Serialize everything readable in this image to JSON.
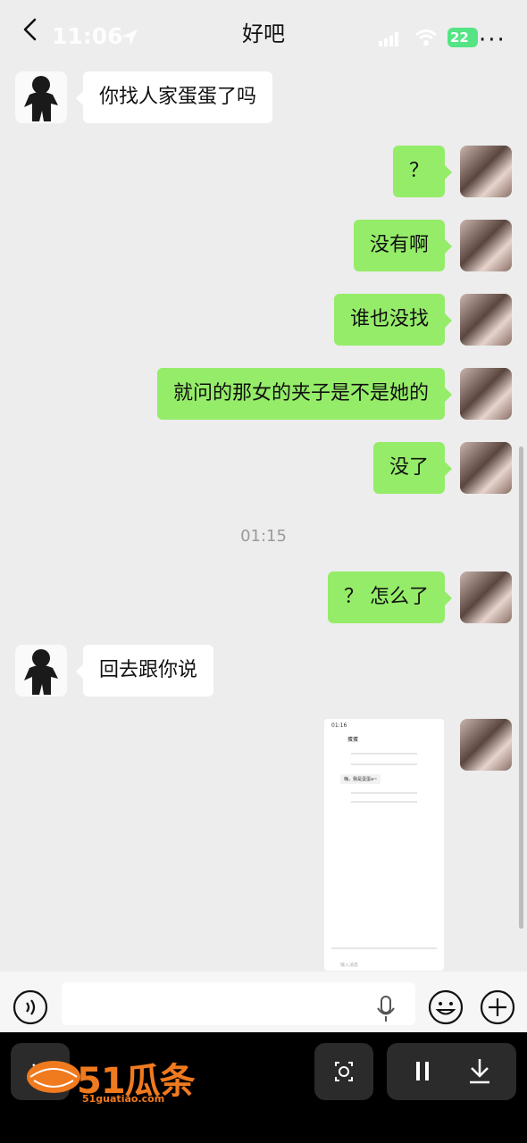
{
  "header": {
    "title": "好吧",
    "time": "11:06",
    "battery": "22",
    "more": "···"
  },
  "messages": [
    {
      "side": "left",
      "text": "你找人家蛋蛋了吗"
    },
    {
      "side": "right",
      "text": "？"
    },
    {
      "side": "right",
      "text": "没有啊"
    },
    {
      "side": "right",
      "text": "谁也没找"
    },
    {
      "side": "right",
      "text": "就问的那女的夹子是不是她的"
    },
    {
      "side": "right",
      "text": "没了"
    },
    {
      "side": "right",
      "text": "？ 怎么了"
    },
    {
      "side": "left",
      "text": "回去跟你说"
    }
  ],
  "timestamp": "01:15",
  "shared_image": {
    "time": "01:16",
    "name": "蛋蛋",
    "message": "嗨，我是蛋蛋a~",
    "input_placeholder": "输入消息"
  },
  "watermark": {
    "brand": "51瓜条",
    "url": "51guatiao.com"
  },
  "colors": {
    "outgoing_bubble": "#95ec69",
    "incoming_bubble": "#ffffff",
    "background": "#ededed"
  }
}
